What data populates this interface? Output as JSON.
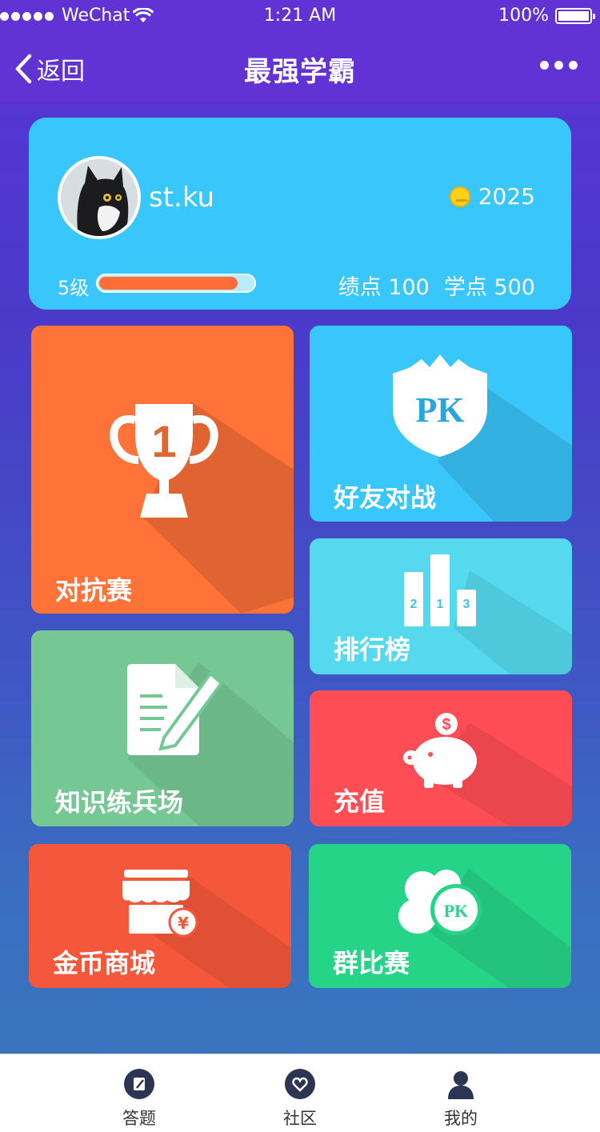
{
  "status_bar": {
    "carrier": "WeChat",
    "time": "1:21 AM",
    "battery": "100%"
  },
  "nav": {
    "back_label": "返回",
    "title": "最强学霸"
  },
  "profile": {
    "username": "st.ku",
    "coins": "2025",
    "level": "5级",
    "level_progress": 0.9,
    "gpa_label": "绩点",
    "gpa_value": "100",
    "points_label": "学点",
    "points_value": "500"
  },
  "tiles": {
    "contest": {
      "label": "对抗赛",
      "icon": "trophy-icon",
      "trophy_number": "1",
      "color": "#ff7238"
    },
    "friend_battle": {
      "label": "好友对战",
      "icon": "pk-shield-icon",
      "pk_text": "PK",
      "color": "#38c6fb"
    },
    "ranking": {
      "label": "排行榜",
      "icon": "podium-icon",
      "ranks": [
        "2",
        "1",
        "3"
      ],
      "color": "#55d9ee"
    },
    "practice": {
      "label": "知识练兵场",
      "icon": "notebook-pen-icon",
      "color": "#75c794"
    },
    "recharge": {
      "label": "充值",
      "icon": "piggy-bank-icon",
      "color": "#ff4d55"
    },
    "shop": {
      "label": "金币商城",
      "icon": "store-icon",
      "currency": "¥",
      "color": "#f4573a"
    },
    "group_contest": {
      "label": "群比赛",
      "icon": "group-pk-icon",
      "pk_text": "PK",
      "color": "#26d488"
    }
  },
  "tabbar": {
    "items": [
      {
        "label": "答题",
        "icon": "quiz-icon"
      },
      {
        "label": "社区",
        "icon": "community-icon"
      },
      {
        "label": "我的",
        "icon": "profile-icon"
      }
    ]
  }
}
